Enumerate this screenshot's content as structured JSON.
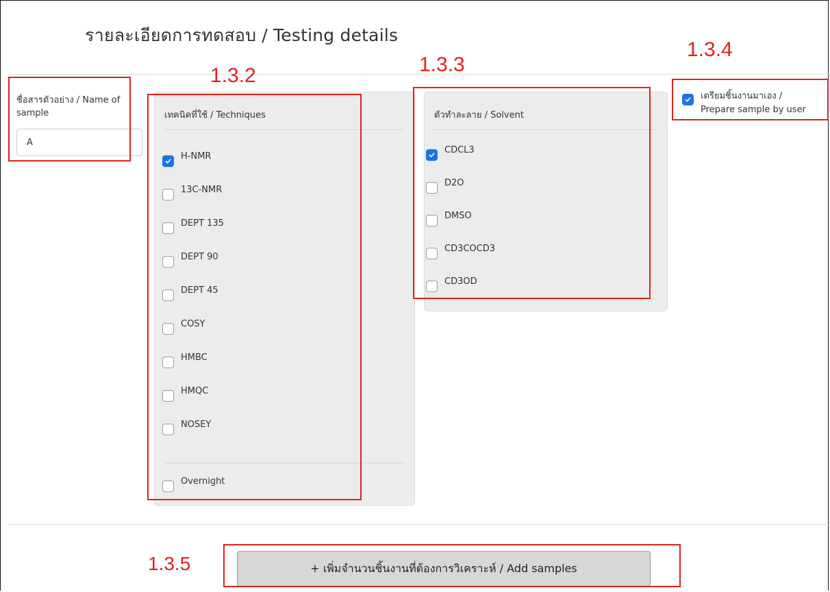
{
  "section_title": "รายละเอียดการทดสอบ / Testing details",
  "annotations": {
    "a132": "1.3.2",
    "a133": "1.3.3",
    "a134": "1.3.4",
    "a135": "1.3.5"
  },
  "sample_name": {
    "label_line1": "ชื่อสารตัวอย่าง / Name of",
    "label_line2": "sample",
    "value": "A"
  },
  "techniques": {
    "heading": "เทคนิคที่ใช้ / Techniques",
    "items": [
      {
        "label": "H-NMR",
        "checked": true
      },
      {
        "label": "13C-NMR",
        "checked": false
      },
      {
        "label": "DEPT 135",
        "checked": false
      },
      {
        "label": "DEPT 90",
        "checked": false
      },
      {
        "label": "DEPT 45",
        "checked": false
      },
      {
        "label": "COSY",
        "checked": false
      },
      {
        "label": "HMBC",
        "checked": false
      },
      {
        "label": "HMQC",
        "checked": false
      },
      {
        "label": "NOSEY",
        "checked": false
      }
    ],
    "overnight": {
      "label": "Overnight",
      "checked": false
    }
  },
  "solvent": {
    "heading": "ตัวทำละลาย / Solvent",
    "items": [
      {
        "label": "CDCL3",
        "checked": true
      },
      {
        "label": "D2O",
        "checked": false
      },
      {
        "label": "DMSO",
        "checked": false
      },
      {
        "label": "CD3COCD3",
        "checked": false
      },
      {
        "label": "CD3OD",
        "checked": false
      }
    ]
  },
  "prepare_by_user": {
    "line1": "เตรียมชิ้นงานมาเอง /",
    "line2": "Prepare sample by user",
    "checked": true
  },
  "add_samples_button": "+ เพิ่มจำนวนชิ้นงานที่ต้องการวิเคราะห์ / Add samples",
  "colors": {
    "annotation": "#e0201c",
    "checkbox_on": "#1a73e8"
  }
}
